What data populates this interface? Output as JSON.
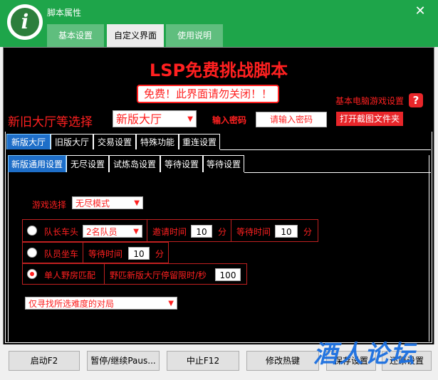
{
  "window": {
    "title": "脚本属性",
    "logo_glyph": "i",
    "close_glyph": "✕"
  },
  "window_tabs": [
    "基本设置",
    "自定义界面",
    "使用说明"
  ],
  "header": {
    "big_title": "LSP免费挑战脚本",
    "notice": "免费！此界面请勿关闭！！",
    "basic_label": "基本电脑游戏设置",
    "help_glyph": "?"
  },
  "hall": {
    "label": "新旧大厅等选择",
    "selected": "新版大厅"
  },
  "password": {
    "label": "输入密码",
    "placeholder": "请输入密码"
  },
  "open_folder_button": "打开截图文件夹",
  "tabs_level1": [
    "新版大厅",
    "旧版大厅",
    "交易设置",
    "特殊功能",
    "重连设置"
  ],
  "tabs_level2": [
    "新版通用设置",
    "无尽设置",
    "试炼岛设置",
    "等待设置",
    "等待设置"
  ],
  "game_select": {
    "label": "游戏选择",
    "selected": "无尽模式"
  },
  "options": {
    "leader": {
      "label": "队长车头",
      "party": "2名队员",
      "invite_label": "邀请时间",
      "invite_value": "10",
      "invite_unit": "分",
      "wait_label": "等待时间",
      "wait_value": "10",
      "wait_unit": "分",
      "selected": false
    },
    "member": {
      "label": "队员坐车",
      "wait_label": "等待时间",
      "wait_value": "10",
      "wait_unit": "分",
      "selected": false
    },
    "solo": {
      "label": "单人野房匹配",
      "limit_label": "野匹新版大厅停留限时/秒",
      "limit_value": "100",
      "selected": true
    }
  },
  "difficulty_select": "仅寻找所选难度的对局",
  "bottom_buttons": [
    "启动F2",
    "暂停/继续Paus...",
    "中止F12",
    "修改热键",
    "保存设置",
    "还原设置"
  ],
  "watermark": "酒人论坛",
  "colors": {
    "titlebar": "#1ea54a",
    "accent_red": "#ff2020",
    "tab_active": "#1e6ec8",
    "watermark": "#1a6fe0"
  }
}
